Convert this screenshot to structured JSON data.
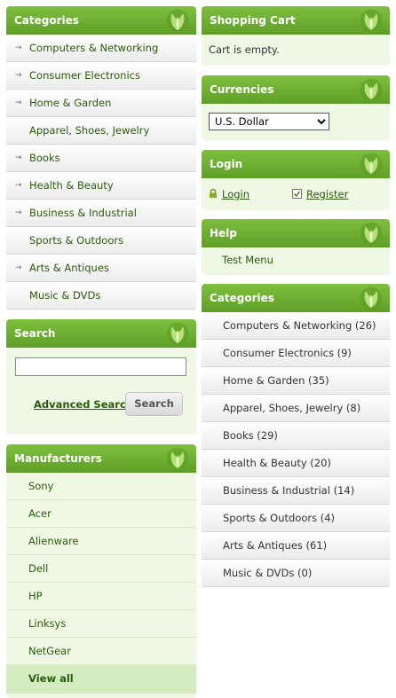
{
  "left": {
    "categories": {
      "title": "Categories",
      "items": [
        {
          "label": "Computers & Networking",
          "arrow": true
        },
        {
          "label": "Consumer Electronics",
          "arrow": true
        },
        {
          "label": "Home & Garden",
          "arrow": true
        },
        {
          "label": "Apparel, Shoes, Jewelry",
          "arrow": false
        },
        {
          "label": "Books",
          "arrow": true
        },
        {
          "label": "Health & Beauty",
          "arrow": true
        },
        {
          "label": "Business & Industrial",
          "arrow": true
        },
        {
          "label": "Sports & Outdoors",
          "arrow": false
        },
        {
          "label": "Arts & Antiques",
          "arrow": true
        },
        {
          "label": "Music & DVDs",
          "arrow": false
        }
      ]
    },
    "search": {
      "title": "Search",
      "input_value": "",
      "advanced_label": "Advanced Search",
      "button_label": "Search"
    },
    "manufacturers": {
      "title": "Manufacturers",
      "items": [
        "Sony",
        "Acer",
        "Alienware",
        "Dell",
        "HP",
        "Linksys",
        "NetGear"
      ],
      "view_all": "View all"
    }
  },
  "right": {
    "cart": {
      "title": "Shopping Cart",
      "status": "Cart is empty."
    },
    "currencies": {
      "title": "Currencies",
      "selected": "U.S. Dollar"
    },
    "login": {
      "title": "Login",
      "login_label": "Login",
      "register_label": "Register"
    },
    "help": {
      "title": "Help",
      "item": "Test Menu"
    },
    "categories": {
      "title": "Categories",
      "items": [
        "Computers & Networking (26)",
        "Consumer Electronics (9)",
        "Home & Garden (35)",
        "Apparel, Shoes, Jewelry (8)",
        "Books (29)",
        "Health & Beauty (20)",
        "Business & Industrial (14)",
        "Sports & Outdoors (4)",
        "Arts & Antiques (61)",
        "Music & DVDs (0)"
      ]
    }
  },
  "colors": {
    "header_green": "#6aad2e",
    "box_bg": "#eef8e4",
    "link_green": "#2c5a0c"
  }
}
